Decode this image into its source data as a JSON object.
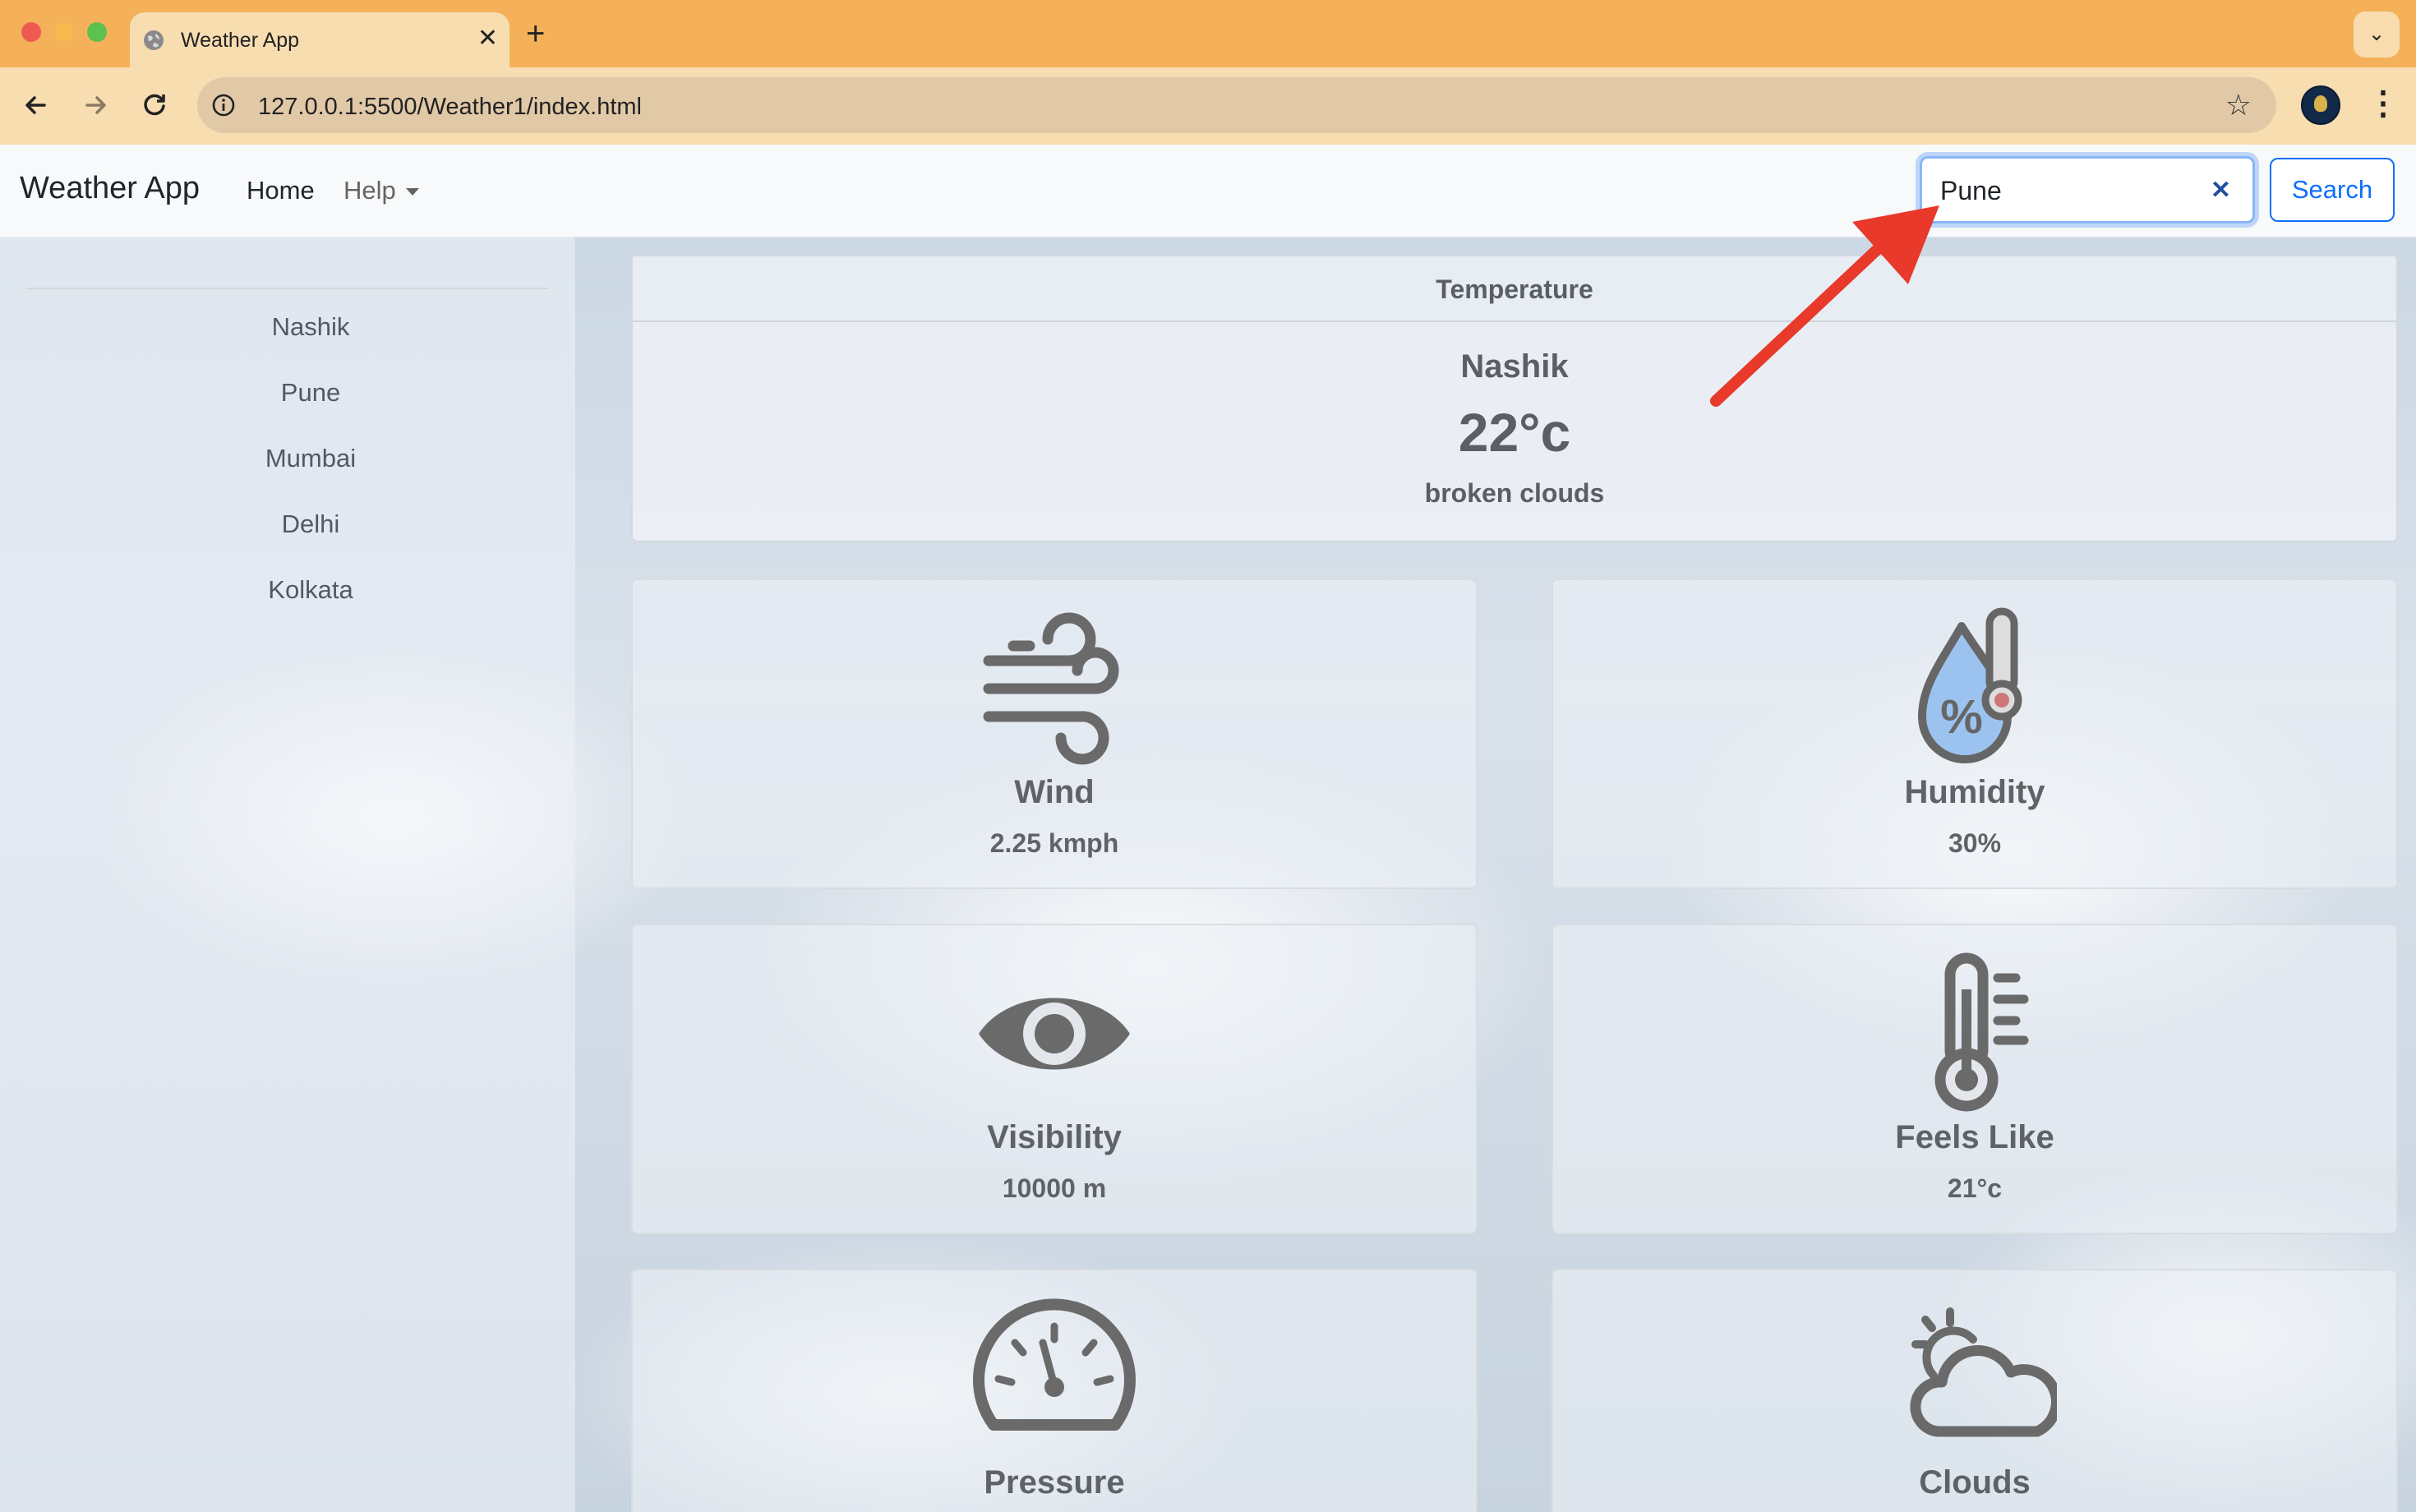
{
  "browser": {
    "tab_title": "Weather App",
    "url": "127.0.0.1:5500/Weather1/index.html"
  },
  "navbar": {
    "brand": "Weather App",
    "home": "Home",
    "help": "Help",
    "search_value": "Pune",
    "search_button": "Search"
  },
  "sidebar": {
    "cities": [
      "Nashik",
      "Pune",
      "Mumbai",
      "Delhi",
      "Kolkata"
    ]
  },
  "temperature": {
    "header": "Temperature",
    "city": "Nashik",
    "value": "22°c",
    "description": "broken clouds"
  },
  "metrics": {
    "wind": {
      "label": "Wind",
      "value": "2.25 kmph",
      "icon": "wind-icon"
    },
    "humidity": {
      "label": "Humidity",
      "value": "30%",
      "icon": "humidity-icon"
    },
    "visibility": {
      "label": "Visibility",
      "value": "10000 m",
      "icon": "eye-icon"
    },
    "feels_like": {
      "label": "Feels Like",
      "value": "21°c",
      "icon": "thermometer-icon"
    },
    "pressure": {
      "label": "Pressure",
      "icon": "gauge-icon"
    },
    "clouds": {
      "label": "Clouds",
      "icon": "cloud-sun-icon"
    }
  },
  "colors": {
    "accent": "#0d6efd",
    "annotation_arrow": "#e8392b",
    "tab_strip": "#f4b15a"
  }
}
